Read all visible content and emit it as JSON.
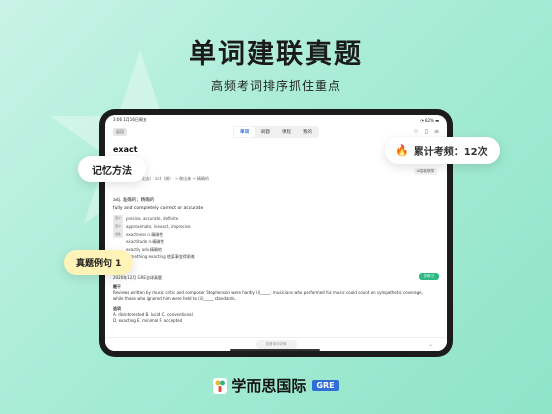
{
  "hero": {
    "title": "单词建联真题",
    "subtitle": "高频考词排序抓住重点"
  },
  "statusbar": {
    "time": "3:06",
    "date": "1月16日周五",
    "battery": "82%"
  },
  "nav": {
    "back_label": "返回",
    "tabs": [
      {
        "label": "单词",
        "active": true
      },
      {
        "label": "刷题",
        "active": false
      },
      {
        "label": "课程",
        "active": false
      },
      {
        "label": "我的",
        "active": false
      }
    ]
  },
  "word": {
    "text": "exact",
    "phonetic": "/ɪɡˈzækt/",
    "memory_line": "记忆：ex（出，出去）  act（做） → 做出来 → 精确的",
    "memory_badge": "AI智能联想"
  },
  "definition": {
    "pos_line": "adj. 准确的；精确的",
    "english": "fully and completely correct or accurate"
  },
  "related": {
    "rows": [
      {
        "tag": "近义",
        "text": "precise, accurate, definite"
      },
      {
        "tag": "近义",
        "text": "approximate, inexact, imprecise"
      },
      {
        "tag": "派生",
        "text": "exactness n.精确性"
      },
      {
        "tag": "",
        "text": "exactitude n.精确性"
      },
      {
        "tag": "",
        "text": "exactly adv.精确地"
      },
      {
        "tag": "搭配",
        "text": "something exacting 使某事变得艰难"
      }
    ]
  },
  "exam": {
    "heading": "2020年12月 GRE全球真题",
    "button": "去练习",
    "prompt_label": "题干",
    "prompt_text": "Reviews written by music critic and composer Stephenson were hardly (i)_____: musicians who performed his music could count on sympathetic coverage, while those who ignored him were held to (ii)_____ standards.",
    "options_label": "选项",
    "options_line1": "A. disinterested  B. lucid  C. conventional",
    "options_line2": "D. exacting  E. minimal  F. accepted"
  },
  "bottom": {
    "pill": "查看单词详情"
  },
  "callouts": {
    "memory": "记忆方法",
    "count": "累计考频：12次",
    "real": "真题例句 1"
  },
  "brand": {
    "name": "学而思国际",
    "tag": "GRE"
  },
  "colors": {
    "accent_green": "#2db884",
    "accent_blue": "#2e6fd8",
    "flame": "#f59a23"
  }
}
